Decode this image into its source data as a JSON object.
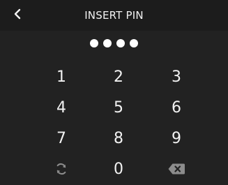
{
  "header": {
    "title": "INSERT PIN",
    "back_icon": "chevron-left-icon"
  },
  "pin": {
    "entered_count": 4
  },
  "keypad": {
    "keys": [
      "1",
      "2",
      "3",
      "4",
      "5",
      "6",
      "7",
      "8",
      "9",
      "0"
    ],
    "refresh_icon": "refresh-icon",
    "backspace_icon": "backspace-icon"
  },
  "colors": {
    "background": "#222222",
    "header": "#1c1c1c",
    "text": "#f2f2f2",
    "icon_muted": "#8c8c8c"
  }
}
